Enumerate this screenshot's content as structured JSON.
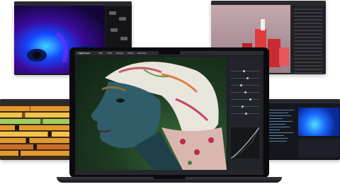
{
  "laptop": {
    "menubar": {
      "items": [
        "Lightroom",
        "File",
        "Edit",
        "Library",
        "Photo",
        "Develop",
        "Window",
        "Help"
      ]
    },
    "inspector": {
      "sliders": [
        0.45,
        0.6,
        0.35,
        0.5,
        0.7,
        0.4,
        0.55
      ]
    }
  },
  "panels": {
    "video": {
      "title": ""
    },
    "scene3d": {
      "title": ""
    },
    "timeline": {
      "title": ""
    },
    "data": {
      "title": ""
    }
  },
  "colors": {
    "laptop_body": "#0b0b0d",
    "timeline_orange": "#e39a2c",
    "timeline_green": "#9fcf5a",
    "scene_red": "#d9363c"
  }
}
